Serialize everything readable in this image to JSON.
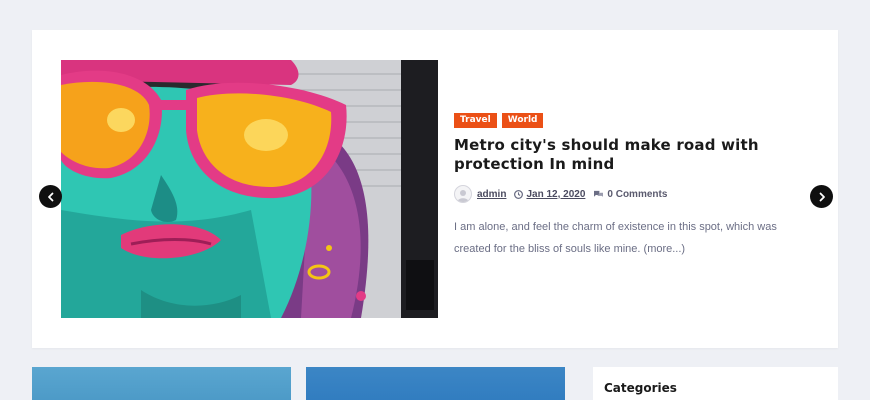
{
  "slider": {
    "image_alt": "Colorful street art mural of a face with pink heart sunglasses",
    "categories": [
      "Travel",
      "World"
    ],
    "title": "Metro city's should make road with protection In mind",
    "author": "admin",
    "date": "Jan 12, 2020",
    "comments": "0 Comments",
    "excerpt": "I am alone, and feel the charm of existence in this spot, which was created for the bliss of souls like mine. (more...)"
  },
  "sidebar": {
    "heading": "Categories"
  },
  "colors": {
    "accent": "#eb5016",
    "page_bg": "#eef0f5",
    "card_bg": "#ffffff",
    "title": "#1a1a1a",
    "excerpt": "#6b6e85"
  },
  "icons": {
    "prev": "chevron-left-icon",
    "next": "chevron-right-icon",
    "clock": "clock-icon",
    "comments": "comments-icon",
    "user": "user-avatar-icon"
  }
}
